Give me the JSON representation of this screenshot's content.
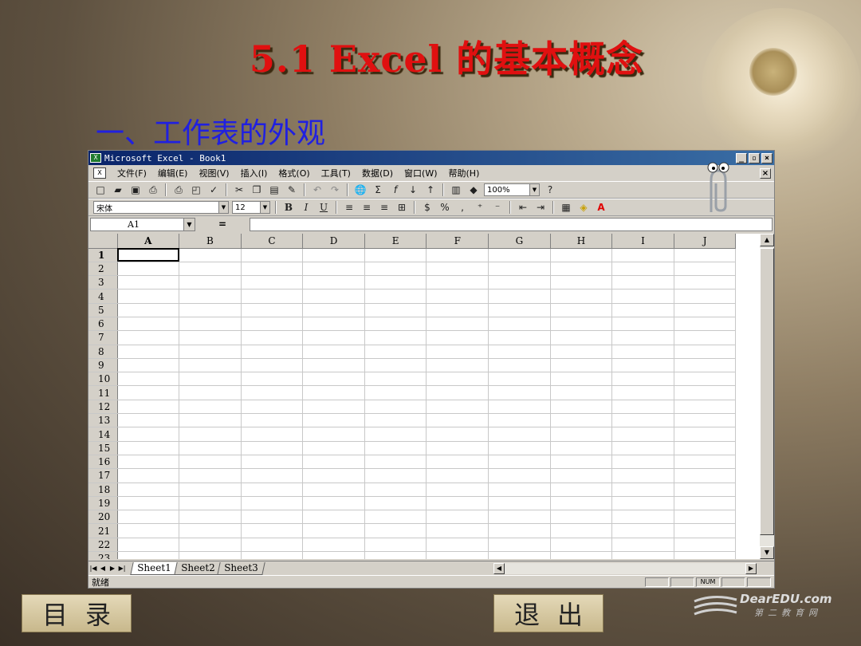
{
  "slide": {
    "title": "5.1  Excel 的基本概念",
    "subtitle": "一、工作表的外观"
  },
  "excel": {
    "window_title": "Microsoft Excel - Book1",
    "menu": [
      "文件(F)",
      "编辑(E)",
      "视图(V)",
      "插入(I)",
      "格式(O)",
      "工具(T)",
      "数据(D)",
      "窗口(W)",
      "帮助(H)"
    ],
    "zoom": "100%",
    "font_name": "宋体",
    "font_size": "12",
    "name_box": "A1",
    "formula_eq": "=",
    "columns": [
      "A",
      "B",
      "C",
      "D",
      "E",
      "F",
      "G",
      "H",
      "I",
      "J"
    ],
    "rows": [
      "1",
      "2",
      "3",
      "4",
      "5",
      "6",
      "7",
      "8",
      "9",
      "10",
      "11",
      "12",
      "13",
      "14",
      "15",
      "16",
      "17",
      "18",
      "19",
      "20",
      "21",
      "22",
      "23"
    ],
    "sheets": [
      "Sheet1",
      "Sheet2",
      "Sheet3"
    ],
    "status_text": "就绪",
    "status_num": "NUM"
  },
  "buttons": {
    "contents": "目录",
    "exit": "退出"
  },
  "logo": {
    "name": "DearEDU.com",
    "sub": "第二教育网"
  }
}
